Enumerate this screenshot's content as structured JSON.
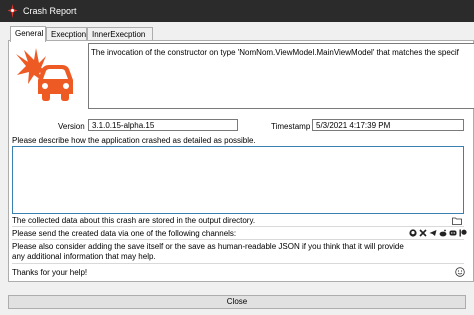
{
  "window": {
    "title": "Crash Report"
  },
  "tabs": [
    {
      "label": "General"
    },
    {
      "label": "Execption"
    },
    {
      "label": "InnerExecption"
    }
  ],
  "general": {
    "message": "The invocation of the constructor on type 'NomNom.ViewModel.MainViewModel' that matches the specif",
    "version_label": "Version",
    "version_value": "3.1.0.15-alpha.15",
    "timestamp_label": "Timestamp",
    "timestamp_value": "5/3/2021 4:17:39 PM",
    "describe_prompt": "Please describe how the application crashed as detailed as possible.",
    "description_value": "",
    "collected_note": "The collected data about this crash are stored in the output directory.",
    "send_note": "Please send the created data via one of the following channels:",
    "consider_note_1": "Please also consider adding the save itself or the save as human-readable JSON if you think that it will provide",
    "consider_note_2": "any additional information that may help.",
    "thanks": "Thanks for your help!"
  },
  "channels": [
    {
      "icon": "github-icon"
    },
    {
      "icon": "nexus-icon"
    },
    {
      "icon": "telegram-icon"
    },
    {
      "icon": "reddit-icon"
    },
    {
      "icon": "discord-icon"
    },
    {
      "icon": "patreon-icon"
    }
  ],
  "buttons": {
    "close_label": "Close"
  },
  "colors": {
    "accent": "#ee5a24",
    "focus_border": "#3c7fb1",
    "titlebar": "#2b2b2b"
  }
}
